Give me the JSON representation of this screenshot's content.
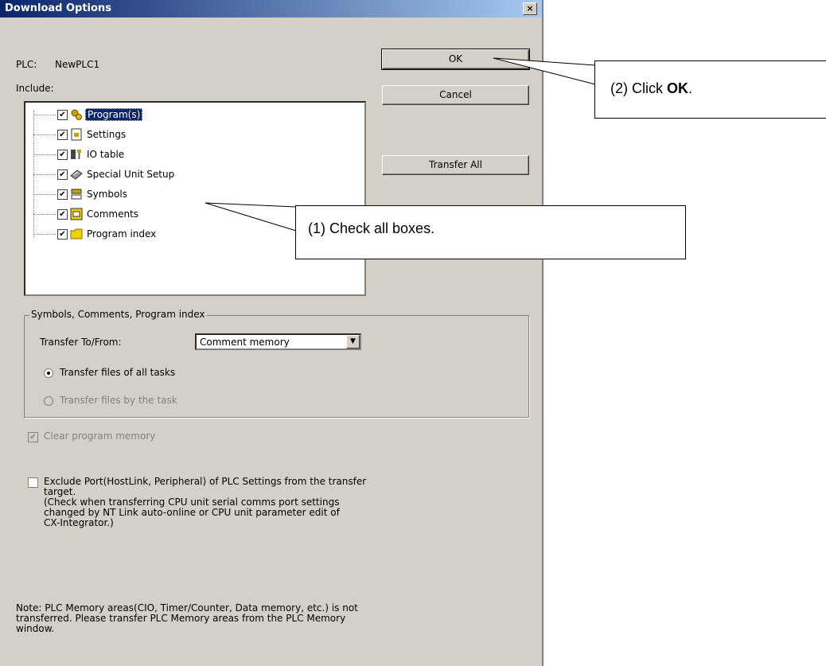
{
  "window": {
    "title": "Download Options",
    "close_glyph": "×"
  },
  "plc": {
    "label": "PLC:",
    "name": "NewPLC1"
  },
  "include_label": "Include:",
  "buttons": {
    "ok": "OK",
    "cancel": "Cancel",
    "transfer_all": "Transfer All"
  },
  "tree_items": [
    {
      "label": "Program(s)",
      "checked": true,
      "icon": "program-icon"
    },
    {
      "label": "Settings",
      "checked": true,
      "icon": "settings-icon"
    },
    {
      "label": "IO table",
      "checked": true,
      "icon": "io-table-icon"
    },
    {
      "label": "Special Unit Setup",
      "checked": true,
      "icon": "special-unit-icon"
    },
    {
      "label": "Symbols",
      "checked": true,
      "icon": "symbols-icon"
    },
    {
      "label": "Comments",
      "checked": true,
      "icon": "comments-icon"
    },
    {
      "label": "Program index",
      "checked": true,
      "icon": "folder-icon"
    }
  ],
  "group": {
    "title": "Symbols, Comments, Program index",
    "transfer_label": "Transfer To/From:",
    "transfer_value": "Comment memory",
    "radio_all": "Transfer files of all tasks",
    "radio_task": "Transfer files by the task"
  },
  "clear_program_memory": "Clear program memory",
  "exclude_port": "Exclude Port(HostLink, Peripheral) of PLC Settings from the transfer\ntarget.\n(Check when transferring CPU unit serial comms port settings\nchanged by NT Link auto-online or CPU unit parameter edit of\nCX-Integrator.)",
  "note": "Note: PLC Memory areas(CIO, Timer/Counter, Data memory, etc.) is not\ntransferred. Please transfer PLC Memory areas from the PLC Memory\nwindow.",
  "callouts": {
    "click_ok_prefix": "(2) Click ",
    "click_ok_bold": "OK",
    "click_ok_suffix": ".",
    "check_all": "(1) Check all boxes."
  },
  "colors": {
    "dialog_bg": "#d4d0c8",
    "title_start": "#0a246a",
    "title_end": "#a6caf0",
    "selection": "#0a246a"
  }
}
